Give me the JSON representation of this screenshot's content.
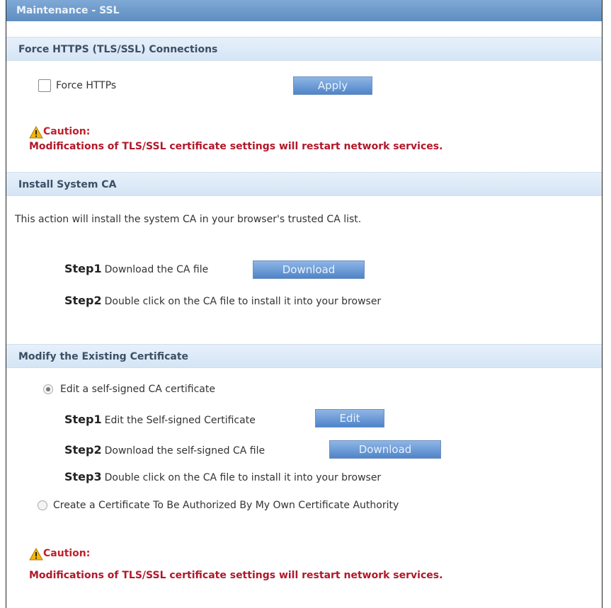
{
  "title": "Maintenance - SSL",
  "force_https": {
    "header": "Force HTTPS (TLS/SSL) Connections",
    "checkbox_label": "Force HTTPs",
    "apply_label": "Apply",
    "caution_label": "Caution:",
    "caution_message": "Modifications of TLS/SSL certificate settings will restart network services."
  },
  "install_ca": {
    "header": "Install System CA",
    "description": "This action will install the system CA in your browser's trusted CA list.",
    "step1_label": "Step1",
    "step1_text": "Download the CA file",
    "download_label": "Download",
    "step2_label": "Step2",
    "step2_text": "Double click on the CA file to install it into your browser"
  },
  "modify_cert": {
    "header": "Modify the Existing Certificate",
    "option1_label": "Edit a self-signed CA certificate",
    "step1_label": "Step1",
    "step1_text": "Edit the Self-signed Certificate",
    "edit_label": "Edit",
    "step2_label": "Step2",
    "step2_text": "Download the self-signed CA file",
    "download_label": "Download",
    "step3_label": "Step3",
    "step3_text": "Double click on the CA file to install it into your browser",
    "option2_label": "Create a Certificate To Be Authorized By My Own Certificate Authority",
    "caution_label": "Caution:",
    "caution_message": "Modifications of TLS/SSL certificate settings will restart network services."
  }
}
